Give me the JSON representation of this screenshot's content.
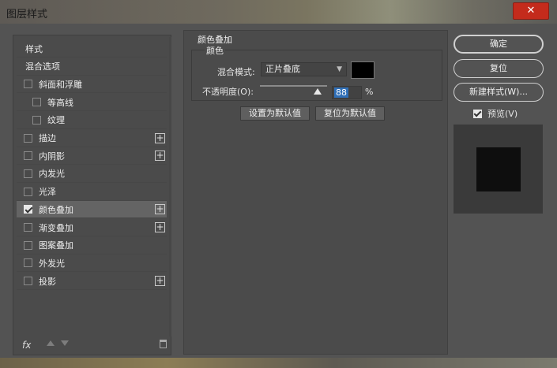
{
  "window": {
    "title": "图层样式",
    "close_glyph": "✕"
  },
  "left": {
    "items": [
      {
        "label": "样式",
        "checkbox": false,
        "checked": false,
        "indent": false,
        "plus": false,
        "selected": false
      },
      {
        "label": "混合选项",
        "checkbox": false,
        "checked": false,
        "indent": false,
        "plus": false,
        "selected": false
      },
      {
        "label": "斜面和浮雕",
        "checkbox": true,
        "checked": false,
        "indent": false,
        "plus": false,
        "selected": false
      },
      {
        "label": "等高线",
        "checkbox": true,
        "checked": false,
        "indent": true,
        "plus": false,
        "selected": false
      },
      {
        "label": "纹理",
        "checkbox": true,
        "checked": false,
        "indent": true,
        "plus": false,
        "selected": false
      },
      {
        "label": "描边",
        "checkbox": true,
        "checked": false,
        "indent": false,
        "plus": true,
        "selected": false
      },
      {
        "label": "内阴影",
        "checkbox": true,
        "checked": false,
        "indent": false,
        "plus": true,
        "selected": false
      },
      {
        "label": "内发光",
        "checkbox": true,
        "checked": false,
        "indent": false,
        "plus": false,
        "selected": false
      },
      {
        "label": "光泽",
        "checkbox": true,
        "checked": false,
        "indent": false,
        "plus": false,
        "selected": false
      },
      {
        "label": "颜色叠加",
        "checkbox": true,
        "checked": true,
        "indent": false,
        "plus": true,
        "selected": true
      },
      {
        "label": "渐变叠加",
        "checkbox": true,
        "checked": false,
        "indent": false,
        "plus": true,
        "selected": false
      },
      {
        "label": "图案叠加",
        "checkbox": true,
        "checked": false,
        "indent": false,
        "plus": false,
        "selected": false
      },
      {
        "label": "外发光",
        "checkbox": true,
        "checked": false,
        "indent": false,
        "plus": false,
        "selected": false
      },
      {
        "label": "投影",
        "checkbox": true,
        "checked": false,
        "indent": false,
        "plus": true,
        "selected": false
      }
    ],
    "toolbar": {
      "fx_label": "fx"
    }
  },
  "middle": {
    "section_title": "颜色叠加",
    "group_title": "颜色",
    "blend_label": "混合模式:",
    "blend_value": "正片叠底",
    "overlay_color": "#000000",
    "opacity_label": "不透明度(O):",
    "opacity_value": "88",
    "opacity_unit": "%",
    "set_default": "设置为默认值",
    "reset_default": "复位为默认值"
  },
  "right": {
    "ok": "确定",
    "reset": "复位",
    "new_style": "新建样式(W)...",
    "preview_label": "预览(V)",
    "preview_checked": true
  },
  "colors": {
    "accent": "#2f6fb7",
    "close": "#c42b1c",
    "panel": "#535353"
  }
}
